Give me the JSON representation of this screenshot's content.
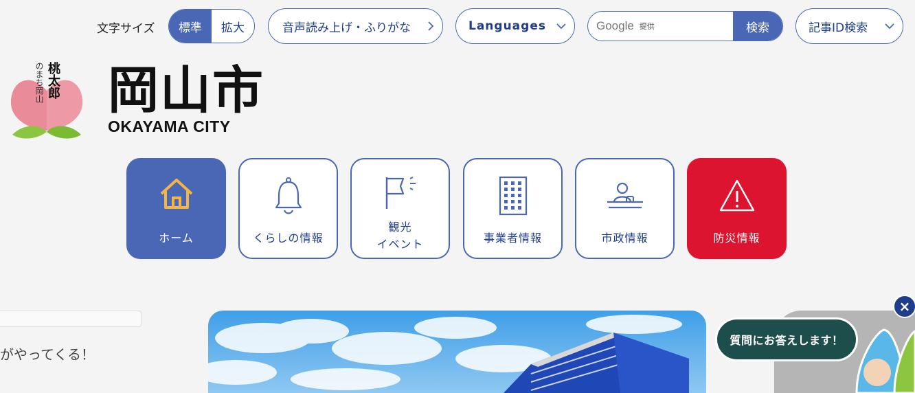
{
  "font_size": {
    "label": "文字サイズ",
    "options": [
      "標準",
      "拡大"
    ]
  },
  "header_links": {
    "ruby": "音声読み上げ・ふりがな",
    "languages": "Languages",
    "article_id": "記事ID検索"
  },
  "search": {
    "provider": "Google",
    "provider_suffix": "提供",
    "button": "検索"
  },
  "logo": {
    "title": "岡山市",
    "subtitle": "OKAYAMA CITY",
    "mascot_small": "のまち岡山",
    "mascot_big": "桃太郎"
  },
  "nav": [
    {
      "label": "ホーム",
      "icon": "home-icon"
    },
    {
      "label": "くらしの情報",
      "icon": "bell-icon"
    },
    {
      "label": "観光\nイベント",
      "icon": "flag-icon"
    },
    {
      "label": "事業者情報",
      "icon": "building-icon"
    },
    {
      "label": "市政情報",
      "icon": "podium-icon"
    },
    {
      "label": "防災情報",
      "icon": "warning-icon"
    }
  ],
  "ticker_text": "がやってくる！",
  "chatbot": {
    "bubble": "質問にお答えします！",
    "close": "×"
  },
  "colors": {
    "primary": "#4a67b5",
    "disaster": "#dc1430",
    "chat": "#1d4e4c"
  }
}
